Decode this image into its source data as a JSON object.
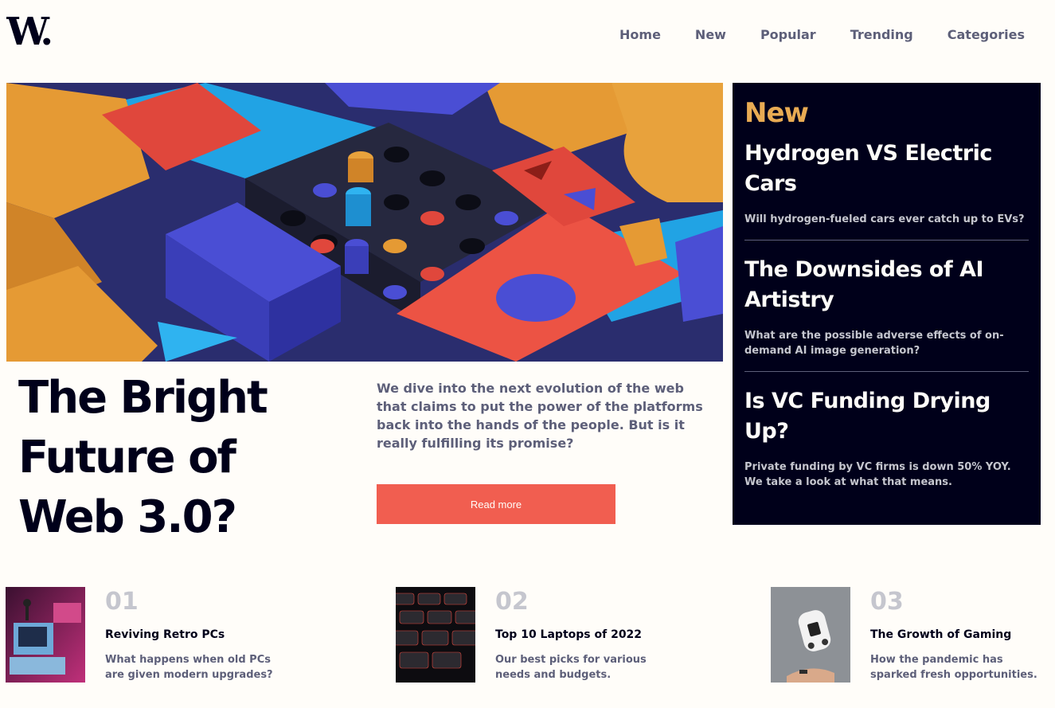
{
  "brand": {
    "logo_text": "W."
  },
  "nav": {
    "items": [
      {
        "label": "Home"
      },
      {
        "label": "New"
      },
      {
        "label": "Popular"
      },
      {
        "label": "Trending"
      },
      {
        "label": "Categories"
      }
    ]
  },
  "hero": {
    "title": "The Bright Future of Web 3.0?",
    "description": "We dive into the next evolution of the web that claims to put the power of the platforms back into the hands of the people. But is it really fulfilling its promise?",
    "button_label": "Read more"
  },
  "new_section": {
    "heading": "New",
    "items": [
      {
        "title": "Hydrogen VS Electric Cars",
        "description": "Will hydrogen-fueled cars ever catch up to EVs?"
      },
      {
        "title": "The Downsides of AI Artistry",
        "description": "What are the possible adverse effects of on-demand AI image generation?"
      },
      {
        "title": "Is VC Funding Drying Up?",
        "description": "Private funding by VC firms is down 50% YOY. We take a look at what that means."
      }
    ]
  },
  "cards": [
    {
      "number": "01",
      "title": "Reviving Retro PCs",
      "description": "What happens when old PCs are given modern upgrades?"
    },
    {
      "number": "02",
      "title": "Top 10 Laptops of 2022",
      "description": "Our best picks for various needs and budgets."
    },
    {
      "number": "03",
      "title": "The Growth of Gaming",
      "description": "How the pandemic has sparked fresh opportunities."
    }
  ],
  "colors": {
    "background": "#fffdf9",
    "dark": "#00001a",
    "accent_orange": "#e9ab53",
    "accent_red": "#f15e50",
    "muted": "#5d5f79",
    "light_muted": "#c5c6ce"
  }
}
